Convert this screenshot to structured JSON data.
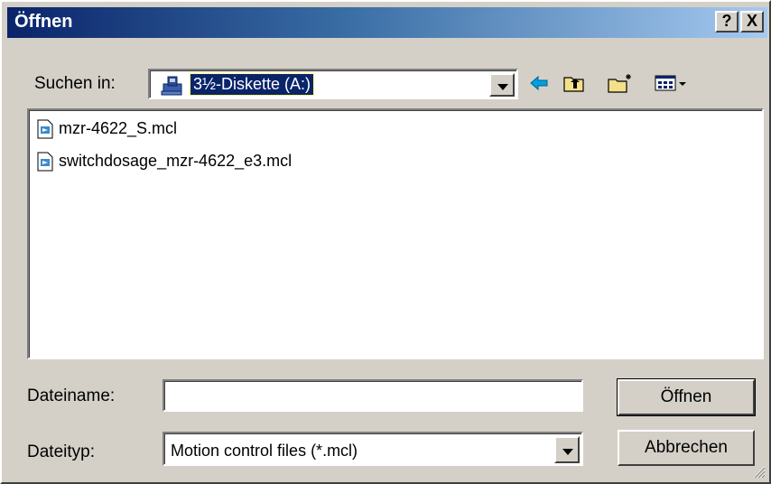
{
  "window": {
    "title": "Öffnen",
    "help_label": "?",
    "close_label": "X"
  },
  "look_in": {
    "label": "Suchen in:",
    "value": "3½-Diskette (A:)",
    "icon": "floppy-drive-icon"
  },
  "toolbar": {
    "back_icon": "back-arrow-icon",
    "up_icon": "up-folder-icon",
    "new_folder_icon": "new-folder-icon",
    "view_icon": "view-menu-icon"
  },
  "files": [
    {
      "name": "mzr-4622_S.mcl",
      "icon": "mcl-file-icon"
    },
    {
      "name": "switchdosage_mzr-4622_e3.mcl",
      "icon": "mcl-file-icon"
    }
  ],
  "filename": {
    "label": "Dateiname:",
    "value": ""
  },
  "filetype": {
    "label": "Dateityp:",
    "value": "Motion control files (*.mcl)"
  },
  "buttons": {
    "open": "Öffnen",
    "cancel": "Abbrechen"
  },
  "colors": {
    "title_start": "#0a246a",
    "title_end": "#a6caf0",
    "face": "#d4d0c8",
    "selection": "#0a246a"
  }
}
